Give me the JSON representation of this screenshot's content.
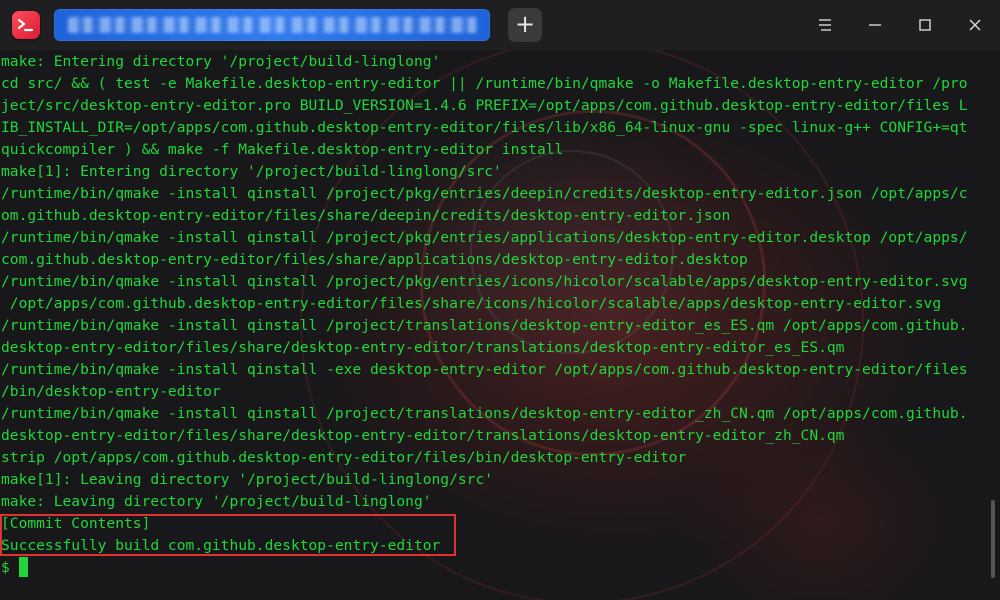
{
  "titlebar": {
    "tab_title": "",
    "add_tab_label": "+",
    "app_icon": "terminal-app-icon",
    "controls": [
      "menu-icon",
      "minimize-icon",
      "maximize-icon",
      "close-icon"
    ]
  },
  "terminal": {
    "lines": [
      "make: Entering directory '/project/build-linglong'",
      "cd src/ && ( test -e Makefile.desktop-entry-editor || /runtime/bin/qmake -o Makefile.desktop-entry-editor /pro",
      "ject/src/desktop-entry-editor.pro BUILD_VERSION=1.4.6 PREFIX=/opt/apps/com.github.desktop-entry-editor/files L",
      "IB_INSTALL_DIR=/opt/apps/com.github.desktop-entry-editor/files/lib/x86_64-linux-gnu -spec linux-g++ CONFIG+=qt",
      "quickcompiler ) && make -f Makefile.desktop-entry-editor install",
      "make[1]: Entering directory '/project/build-linglong/src'",
      "/runtime/bin/qmake -install qinstall /project/pkg/entries/deepin/credits/desktop-entry-editor.json /opt/apps/c",
      "om.github.desktop-entry-editor/files/share/deepin/credits/desktop-entry-editor.json",
      "/runtime/bin/qmake -install qinstall /project/pkg/entries/applications/desktop-entry-editor.desktop /opt/apps/",
      "com.github.desktop-entry-editor/files/share/applications/desktop-entry-editor.desktop",
      "/runtime/bin/qmake -install qinstall /project/pkg/entries/icons/hicolor/scalable/apps/desktop-entry-editor.svg",
      " /opt/apps/com.github.desktop-entry-editor/files/share/icons/hicolor/scalable/apps/desktop-entry-editor.svg",
      "/runtime/bin/qmake -install qinstall /project/translations/desktop-entry-editor_es_ES.qm /opt/apps/com.github.",
      "desktop-entry-editor/files/share/desktop-entry-editor/translations/desktop-entry-editor_es_ES.qm",
      "/runtime/bin/qmake -install qinstall -exe desktop-entry-editor /opt/apps/com.github.desktop-entry-editor/files",
      "/bin/desktop-entry-editor",
      "/runtime/bin/qmake -install qinstall /project/translations/desktop-entry-editor_zh_CN.qm /opt/apps/com.github.",
      "desktop-entry-editor/files/share/desktop-entry-editor/translations/desktop-entry-editor_zh_CN.qm",
      "strip /opt/apps/com.github.desktop-entry-editor/files/bin/desktop-entry-editor",
      "make[1]: Leaving directory '/project/build-linglong/src'",
      "make: Leaving directory '/project/build-linglong'",
      "[Commit Contents]",
      "Successfully build com.github.desktop-entry-editor",
      "$ "
    ],
    "text_color": "#21d63a",
    "highlight_color": "#e0322f"
  }
}
